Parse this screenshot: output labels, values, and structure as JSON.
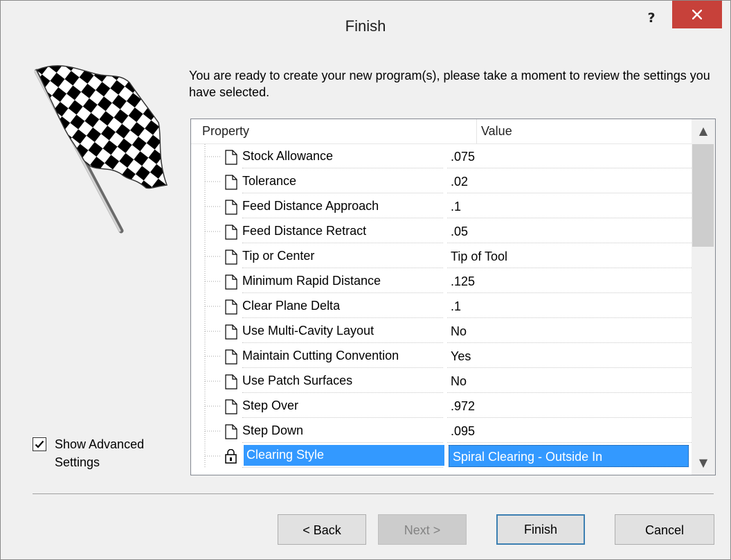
{
  "window": {
    "title": "Finish",
    "help_label": "?"
  },
  "intro_text": "You are ready to create your new program(s), please take a moment to review the settings you have selected.",
  "grid": {
    "columns": [
      "Property",
      "Value"
    ],
    "rows": [
      {
        "property": "Stock Allowance",
        "value": ".075"
      },
      {
        "property": "Tolerance",
        "value": ".02"
      },
      {
        "property": "Feed Distance Approach",
        "value": ".1"
      },
      {
        "property": "Feed Distance Retract",
        "value": ".05"
      },
      {
        "property": "Tip or Center",
        "value": "Tip of Tool"
      },
      {
        "property": "Minimum Rapid Distance",
        "value": ".125"
      },
      {
        "property": "Clear Plane Delta",
        "value": ".1"
      },
      {
        "property": "Use Multi-Cavity Layout",
        "value": "No"
      },
      {
        "property": "Maintain Cutting Convention",
        "value": "Yes"
      },
      {
        "property": "Use Patch Surfaces",
        "value": "No"
      },
      {
        "property": "Step Over",
        "value": ".972"
      },
      {
        "property": "Step Down",
        "value": ".095"
      },
      {
        "property": "Clearing Style",
        "value": "Spiral Clearing - Outside In",
        "selected": true,
        "icon": "lock-icon"
      }
    ]
  },
  "advanced": {
    "label": "Show Advanced Settings",
    "checked": true
  },
  "buttons": {
    "back": "< Back",
    "next": "Next >",
    "finish": "Finish",
    "cancel": "Cancel"
  },
  "colors": {
    "selection": "#3399ff",
    "close_button": "#c7413a"
  }
}
